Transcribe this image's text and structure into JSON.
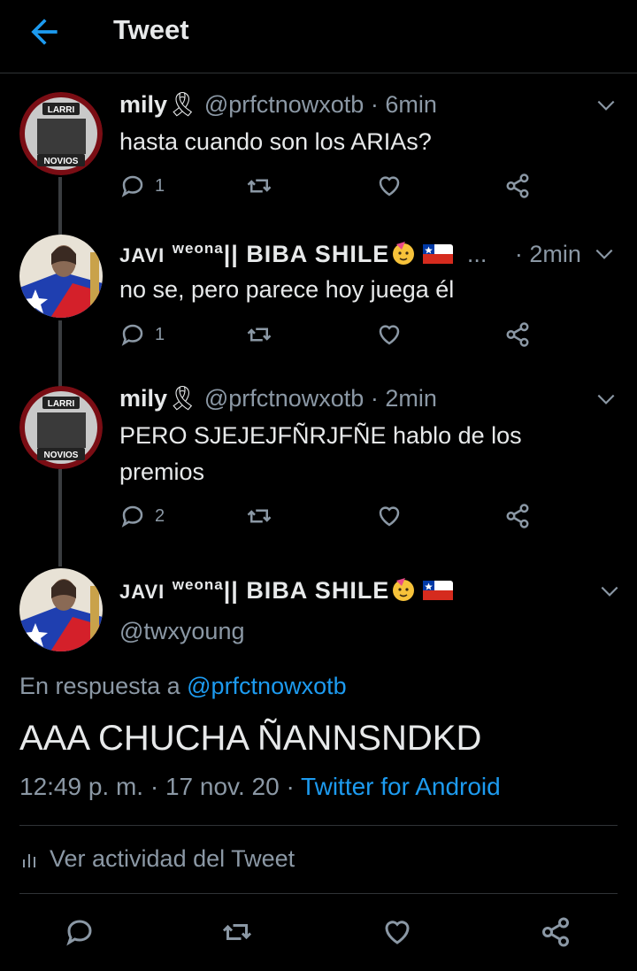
{
  "header": {
    "title": "Tweet"
  },
  "thread": [
    {
      "name": "mily",
      "handle": "@prfctnowxotb",
      "time": "· 6min",
      "text": "hasta cuando son los ARIAs?",
      "replies": "1",
      "avatar_labels": [
        "LARRI",
        "NOVIOS"
      ]
    },
    {
      "name_prefix": "JAVI",
      "name_sup": "weona",
      "name_rest": "|| BIBA SHILE",
      "ellipsis": "...",
      "time": "· 2min",
      "text": "no se, pero parece hoy juega él",
      "replies": "1"
    },
    {
      "name": "mily",
      "handle": "@prfctnowxotb",
      "time": "· 2min",
      "text": "PERO SJEJEJFÑRJFÑE hablo de los premios",
      "replies": "2",
      "avatar_labels": [
        "LARRI",
        "NOVIOS"
      ]
    }
  ],
  "main": {
    "name_prefix": "JAVI",
    "name_sup": "weona",
    "name_rest": "|| BIBA SHILE",
    "handle": "@twxyoung",
    "reply_prefix": "En respuesta a",
    "reply_to": "@prfctnowxotb",
    "text": "AAA CHUCHA ÑANNSNDKD",
    "timestamp": "12:49 p. m. · 17 nov. 20 ·",
    "client": "Twitter for Android",
    "activity": "Ver actividad del Tweet"
  },
  "colors": {
    "accent": "#1d9bf0",
    "background": "#000000",
    "muted": "#8b98a5"
  }
}
